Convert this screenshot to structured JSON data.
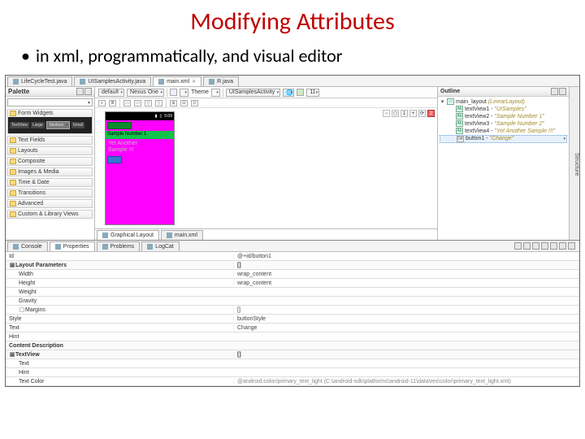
{
  "slide": {
    "title": "Modifying Attributes",
    "bullet": "in xml, programmatically, and visual editor"
  },
  "editor_tabs": [
    {
      "label": "LifeCycleTest.java",
      "active": false
    },
    {
      "label": "UISamplesActivity.java",
      "active": false
    },
    {
      "label": "main.xml",
      "active": true
    },
    {
      "label": "R.java",
      "active": false
    }
  ],
  "palette": {
    "title": "Palette",
    "groups": [
      {
        "label": "Form Widgets"
      },
      {
        "label": "Text Fields"
      },
      {
        "label": "Layouts"
      },
      {
        "label": "Composite"
      },
      {
        "label": "Images & Media"
      },
      {
        "label": "Time & Date"
      },
      {
        "label": "Transitions"
      },
      {
        "label": "Advanced"
      },
      {
        "label": "Custom & Library Views"
      }
    ],
    "widgets": {
      "a": "TextView",
      "b": "Large",
      "c": "Medium",
      "d": "Small"
    }
  },
  "canvas_toolbar": {
    "config": "default",
    "device": "Nexus One",
    "theme_label": "Theme",
    "activity": "UISamplesActivity",
    "api": "11"
  },
  "preview": {
    "status_time": "5:09",
    "bar_text": "Sample Number 1",
    "gray_text1": "Yet Another",
    "gray_text2": "Sample !!!"
  },
  "canvas_bottom_tabs": {
    "graphical": "Graphical Layout",
    "xml": "main.xml"
  },
  "outline": {
    "title": "Outline",
    "root": {
      "id": "main_layout",
      "type": "LinearLayout"
    },
    "children": [
      {
        "id": "textView1",
        "text": "UISamples"
      },
      {
        "id": "textView2",
        "text": "Sample Number 1"
      },
      {
        "id": "textView3",
        "text": "Sample Number 2"
      },
      {
        "id": "textView4",
        "text": "Yet Another Sample !!!"
      },
      {
        "id": "button1",
        "text": "Change"
      }
    ]
  },
  "structure_label": "Structure",
  "props_tabs": [
    "Console",
    "Properties",
    "Problems",
    "LogCat"
  ],
  "properties": {
    "id_key": "Id",
    "id_val": "@+id/button1",
    "layout_section": "Layout Parameters",
    "width_key": "Width",
    "width_val": "wrap_content",
    "height_key": "Height",
    "height_val": "wrap_content",
    "weight_key": "Weight",
    "gravity_key": "Gravity",
    "margins_key": "Margins",
    "margins_val": "[]",
    "style_key": "Style",
    "style_val": "buttonStyle",
    "text_key": "Text",
    "text_val": "Change",
    "hint_key": "Hint",
    "cd_key": "Content Description",
    "tv_key": "TextView",
    "tv_val": "[]",
    "text2_key": "Text",
    "hint2_key": "Hint",
    "tc_key": "Text Color",
    "tc_val": "@android:color/primary_text_light (C:\\android-sdk\\platforms\\android-11\\data\\res\\color\\primary_text_light.xml)"
  }
}
